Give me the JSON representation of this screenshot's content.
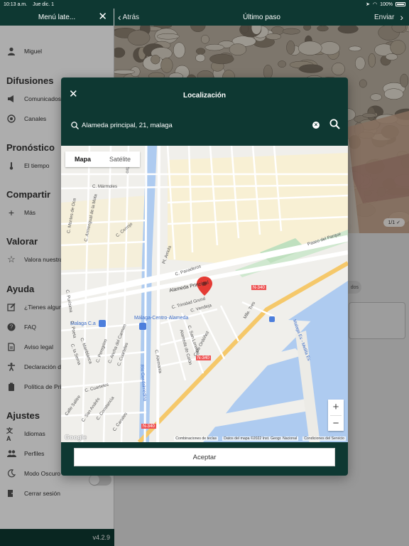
{
  "status_bar": {
    "time": "10:13 a.m.",
    "date": "Jue dic. 1",
    "battery": "100%"
  },
  "side_menu": {
    "title": "Menú late...",
    "user": "Miguel",
    "sections": {
      "difusiones": "Difusiones",
      "pronostico": "Pronóstico",
      "compartir": "Compartir",
      "valorar": "Valorar",
      "ayuda": "Ayuda",
      "ajustes": "Ajustes"
    },
    "items": {
      "comunicados": "Comunicados",
      "canales": "Canales",
      "tiempo": "El tiempo",
      "mas": "Más",
      "valora": "Valora nuestra app",
      "dudas": "¿Tienes alguna duda?",
      "faq": "FAQ",
      "aviso": "Aviso legal",
      "accesibilidad": "Declaración de accesibilidad",
      "privacidad": "Política de Privacidad",
      "idiomas": "Idiomas",
      "perfiles": "Perfiles",
      "modo_oscuro": "Modo Oscuro",
      "cerrar": "Cerrar sesión"
    },
    "version": "v4.2.9"
  },
  "topbar": {
    "back_label": "Atrás",
    "title": "Último paso",
    "send_label": "Enviar"
  },
  "photo": {
    "counter": "1/1"
  },
  "background": {
    "chip_text": "dos"
  },
  "modal": {
    "title": "Localización",
    "search_value": "Alameda principal, 21, malaga",
    "map_types": {
      "map": "Mapa",
      "satellite": "Satélite"
    },
    "map_labels": {
      "jara": "C. Jara",
      "tiro": "Tiro",
      "marmoles": "C. Mármoles",
      "montes_oca": "C. Montes de Oca",
      "armengual": "C. Armengual de la Mota",
      "cerrojo": "C. Cerrojo",
      "arriola": "Pl. Arriola",
      "panaderos": "C. Panaderos",
      "paseo_parque": "Paseo del Parque",
      "alameda": "Alameda Principal",
      "trinidad": "C. Trinidad Grund",
      "vendeja": "C. Vendeja",
      "n340_a": "N-340",
      "n340_b": "N-340",
      "n340_c": "N-340",
      "muelle": "Mlle. Tres",
      "malaga_ca": "Malaga C.a",
      "malaga_centro": "Málaga-Centro-Alameda",
      "maestranza": "Malaga Es - Melilla Es",
      "guadalmedina": "Río Guadalmedina",
      "barroso": "C. San Lorenzo",
      "colon": "Alameda de Colón",
      "cuarteles": "C. Cuarteles",
      "salitre": "Calle Salitre",
      "san_andres": "C. San Andrés",
      "constancia": "C. Constancia",
      "canales": "C. Canales",
      "serna": "C. la Serna",
      "mariblanca": "C. Mariblanca",
      "peregrino": "C. Peregrino",
      "ancha_carmen": "C. Ancha del Carmen",
      "poeta": "C. Poeta",
      "cuarteles2": "C. Cuarteles",
      "alemania": "C. Alemania",
      "ordoñez": "Calle Ordóñez",
      "dianasta": "C. Purísima"
    },
    "footer": {
      "shortcuts": "Combinaciones de teclas",
      "map_data": "Datos del mapa ©2022 Inst. Geogr. Nacional",
      "terms": "Condiciones del Servicio"
    },
    "google": "Google",
    "accept": "Aceptar"
  }
}
